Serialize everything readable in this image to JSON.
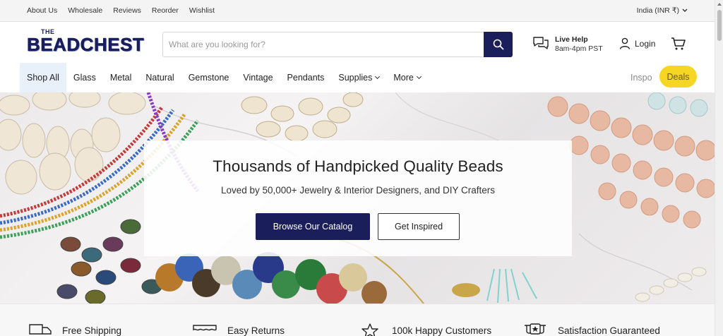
{
  "topbar": {
    "links": [
      "About Us",
      "Wholesale",
      "Reviews",
      "Reorder",
      "Wishlist"
    ],
    "currency": "India (INR ₹)"
  },
  "header": {
    "logo_the": "THE",
    "logo_name": "BEADCHEST",
    "search_placeholder": "What are you looking for?",
    "search_value": "",
    "live_help_title": "Live Help",
    "live_help_hours": "8am-4pm PST",
    "login_label": "Login"
  },
  "nav": {
    "items": [
      {
        "label": "Shop All",
        "dropdown": false
      },
      {
        "label": "Glass",
        "dropdown": false
      },
      {
        "label": "Metal",
        "dropdown": false
      },
      {
        "label": "Natural",
        "dropdown": false
      },
      {
        "label": "Gemstone",
        "dropdown": false
      },
      {
        "label": "Vintage",
        "dropdown": false
      },
      {
        "label": "Pendants",
        "dropdown": false
      },
      {
        "label": "Supplies",
        "dropdown": true
      },
      {
        "label": "More",
        "dropdown": true
      }
    ],
    "inspo_label": "Inspo",
    "deals_label": "Deals"
  },
  "hero": {
    "title": "Thousands of Handpicked Quality Beads",
    "subtitle": "Loved by 50,000+ Jewelry & Interior Designers, and DIY Crafters",
    "primary_cta": "Browse Our Catalog",
    "secondary_cta": "Get Inspired"
  },
  "features": [
    {
      "label": "Free Shipping",
      "icon": "truck-icon"
    },
    {
      "label": "Easy Returns",
      "icon": "returns-box-icon"
    },
    {
      "label": "100k Happy Customers",
      "icon": "star-icon"
    },
    {
      "label": "Satisfaction Guaranteed",
      "icon": "award-icon"
    }
  ],
  "colors": {
    "brand_navy": "#1a1f5c",
    "deals_yellow": "#f6d624",
    "nav_active_bg": "#e8f1fa"
  }
}
